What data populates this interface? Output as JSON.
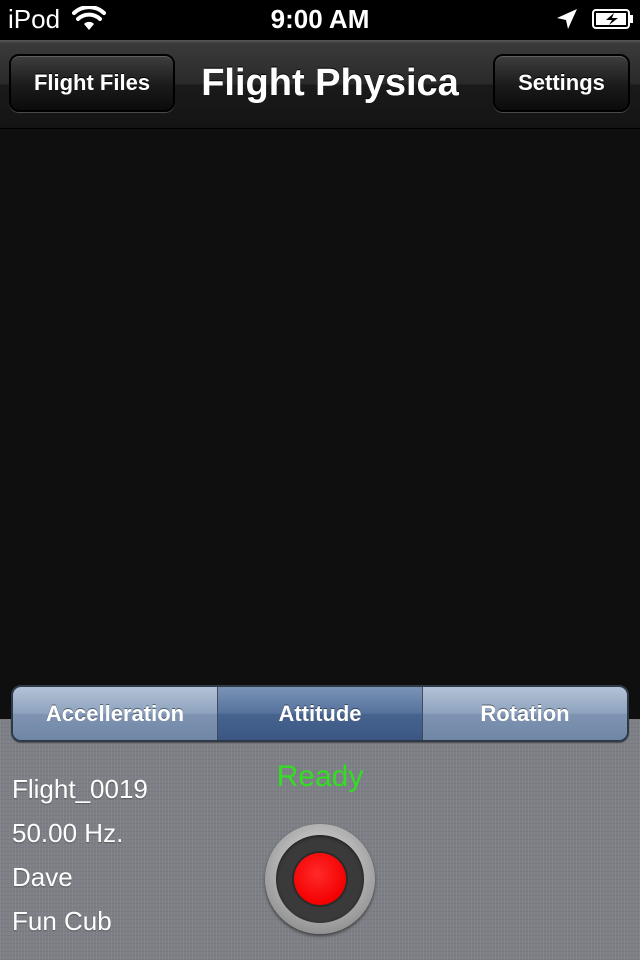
{
  "status_bar": {
    "carrier": "iPod",
    "time": "9:00 AM",
    "icons": [
      "wifi-icon",
      "location-arrow-icon",
      "battery-charging-icon"
    ]
  },
  "nav_bar": {
    "title": "Flight Physica",
    "left_button": "Flight Files",
    "right_button": "Settings"
  },
  "segments": {
    "items": [
      "Accelleration",
      "Attitude",
      "Rotation"
    ],
    "selected": "Attitude"
  },
  "flight_info": {
    "name": "Flight_0019",
    "rate": "50.00 Hz.",
    "pilot": "Dave",
    "aircraft": "Fun Cub"
  },
  "status": {
    "text": "Ready",
    "color": "#33dd22"
  },
  "record_button": {
    "icon": "record-icon",
    "dot_color": "#ff0000"
  }
}
